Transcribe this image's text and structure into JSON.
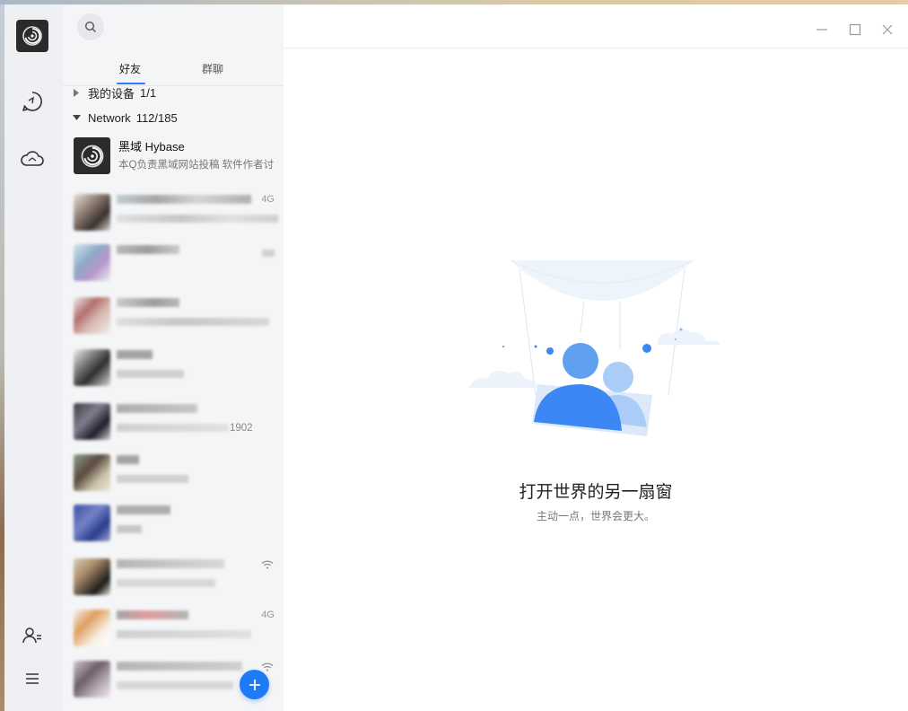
{
  "window": {
    "controls": [
      "minimize",
      "maximize",
      "close"
    ]
  },
  "sidebar": {
    "logo": "app-logo",
    "items": [
      {
        "icon": "chat-icon"
      },
      {
        "icon": "cloud-icon"
      }
    ],
    "bottom": [
      {
        "icon": "contacts-icon"
      },
      {
        "icon": "menu-icon"
      }
    ]
  },
  "contacts_panel": {
    "tabs": [
      {
        "label": "好友",
        "active": true
      },
      {
        "label": "群聊",
        "active": false
      }
    ],
    "groups": [
      {
        "name": "我的设备",
        "count": "1/1",
        "expanded": false
      },
      {
        "name": "Network",
        "count": "112/185",
        "expanded": true
      }
    ],
    "rows": [
      {
        "name": "黑域 Hybase",
        "status": "本Q负责黑域网站投稿 软件作者讨",
        "tag": ""
      },
      {
        "name": "",
        "status": "",
        "tag": "4G"
      },
      {
        "name": "",
        "status": "",
        "tag": ""
      },
      {
        "name": "",
        "status": "",
        "tag": ""
      },
      {
        "name": "",
        "status": "",
        "tag": ""
      },
      {
        "name": "",
        "status": "1902",
        "tag": ""
      },
      {
        "name": "",
        "status": "",
        "tag": ""
      },
      {
        "name": "",
        "status": "",
        "tag": ""
      },
      {
        "name": "",
        "status": "",
        "tag": "wifi"
      },
      {
        "name": "",
        "status": "",
        "tag": "4G"
      },
      {
        "name": "",
        "status": "",
        "tag": "wifi"
      }
    ],
    "fab_icon": "plus-icon"
  },
  "main": {
    "empty_title": "打开世界的另一扇窗",
    "empty_subtitle": "主动一点，世界会更大。"
  },
  "colors": {
    "accent": "#2E7CF6",
    "sidebar_bg": "#EEF0F4",
    "panel_bg": "#F4F5F7"
  }
}
